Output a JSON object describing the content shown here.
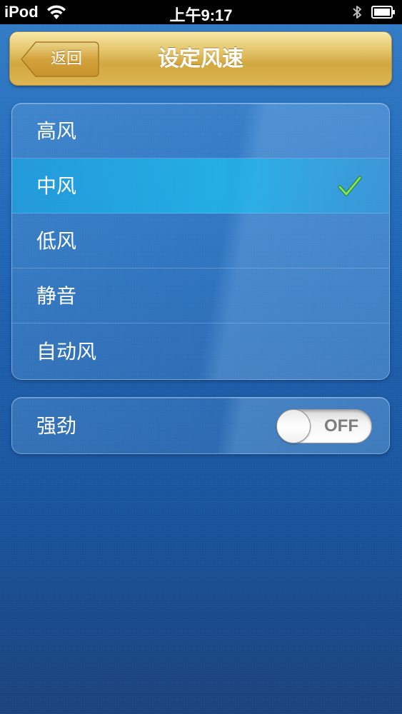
{
  "status_bar": {
    "carrier": "iPod",
    "time": "上午9:17",
    "wifi_icon": "wifi-icon",
    "bluetooth_icon": "bluetooth-icon",
    "battery_icon": "battery-icon"
  },
  "nav": {
    "back_label": "返回",
    "title": "设定风速"
  },
  "speed_options": [
    {
      "label": "高风",
      "selected": false
    },
    {
      "label": "中风",
      "selected": true
    },
    {
      "label": "低风",
      "selected": false
    },
    {
      "label": "静音",
      "selected": false
    },
    {
      "label": "自动风",
      "selected": false
    }
  ],
  "strong": {
    "label": "强劲",
    "toggle_text": "OFF",
    "on": false
  },
  "colors": {
    "nav_gold": "#dcb552",
    "background_blue": "#1d64b4",
    "selected_row": "#1eb4ef",
    "check_green": "#5fd24a"
  }
}
